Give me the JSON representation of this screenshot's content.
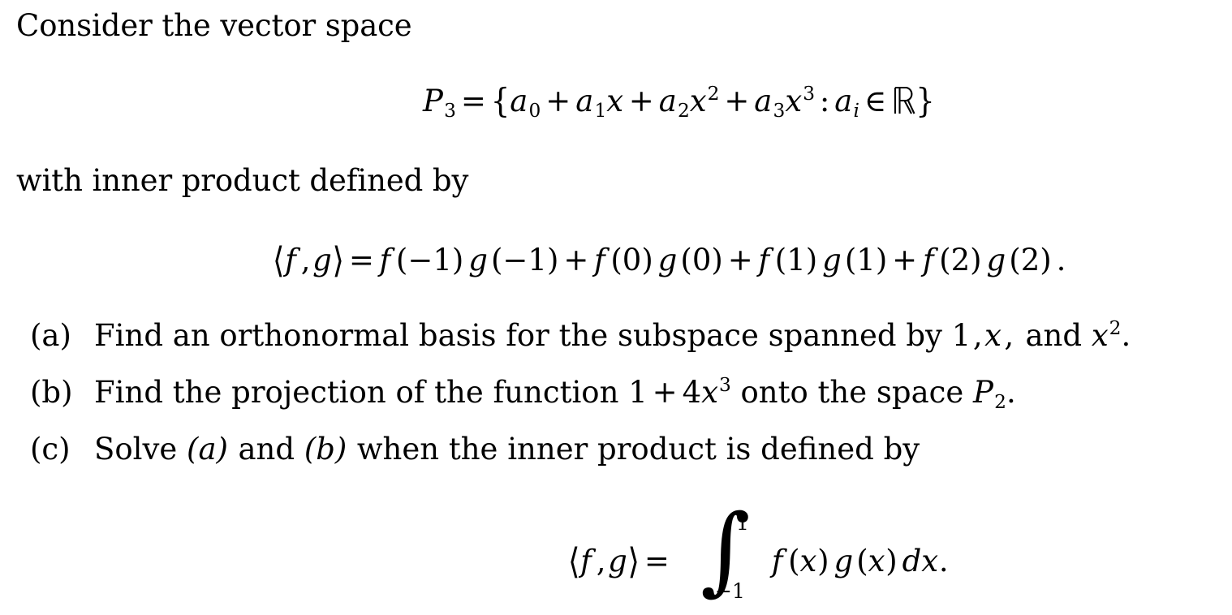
{
  "document": {
    "type": "math-problem",
    "subject": "linear algebra — inner product spaces",
    "background_color": "#ffffff",
    "text_color": "#000000"
  },
  "intro": {
    "line1": "Consider the vector space",
    "line2": "with inner product defined by"
  },
  "equations": {
    "space_definition": {
      "plain": "P_3 = {a_0 + a_1 x + a_2 x^2 + a_3 x^3 : a_i ∈ ℝ}",
      "lhs_symbol": "P",
      "lhs_subscript": "3",
      "equals": "=",
      "open_brace": "{",
      "term0_coef": "a",
      "term0_sub": "0",
      "plus": "+",
      "term1_coef": "a",
      "term1_sub": "1",
      "term1_var": "x",
      "term2_coef": "a",
      "term2_sub": "2",
      "term2_var": "x",
      "term2_exp": "2",
      "term3_coef": "a",
      "term3_sub": "3",
      "term3_var": "x",
      "term3_exp": "3",
      "colon": ":",
      "index_coef": "a",
      "index_sub": "i",
      "member": "∈",
      "reals": "R",
      "close_brace": "}"
    },
    "inner_product_discrete": {
      "plain": "⟨f, g⟩ = f(−1) g(−1) + f(0) g(0) + f(1) g(1) + f(2) g(2) .",
      "angle_open": "⟨",
      "f": "f",
      "comma": ",",
      "g": "g",
      "angle_close": "⟩",
      "equals": "=",
      "plus": "+",
      "paren_open": "(",
      "paren_close": ")",
      "eval_points": [
        "−1",
        "0",
        "1",
        "2"
      ],
      "period": "."
    },
    "inner_product_integral": {
      "plain": "⟨f, g⟩ = ∫_{−1}^{1} f(x) g(x) dx.",
      "angle_open": "⟨",
      "f": "f",
      "comma": ",",
      "g": "g",
      "angle_close": "⟩",
      "equals": "=",
      "integral_sign": "∫",
      "upper_limit": "1",
      "lower_limit": "−1",
      "paren_open": "(",
      "paren_close": ")",
      "variable": "x",
      "differential": "dx",
      "period": "."
    }
  },
  "problems": [
    {
      "label": "(a)",
      "text_before": "Find an orthonormal basis for the subspace spanned by",
      "math_1": "1",
      "math_comma": ",",
      "math_2": "x",
      "text_mid": "and",
      "math_3_base": "x",
      "math_3_exp": "2",
      "period": "."
    },
    {
      "label": "(b)",
      "text_before": "Find the projection of the function",
      "math_1": "1",
      "math_plus": "+",
      "math_coef": "4",
      "math_var": "x",
      "math_exp": "3",
      "text_mid": "onto the space",
      "math_space_base": "P",
      "math_space_sub": "2",
      "period": "."
    },
    {
      "label": "(c)",
      "text_before": "Solve",
      "ref_1": "(a)",
      "text_and": "and",
      "ref_2": "(b)",
      "text_after": "when the inner product is defined by"
    }
  ]
}
